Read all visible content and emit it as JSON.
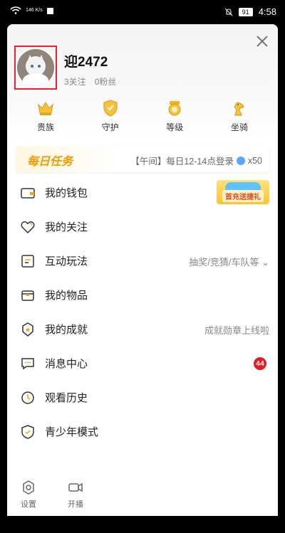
{
  "status_bar": {
    "speed": "146\nK/s",
    "battery": "91",
    "time": "4:58"
  },
  "profile": {
    "username": "迎2472",
    "following": "3关注",
    "fans": "0粉丝"
  },
  "quick_actions": [
    {
      "label": "贵族",
      "icon": "crown-icon"
    },
    {
      "label": "守护",
      "icon": "shield-icon"
    },
    {
      "label": "等级",
      "icon": "badge-icon"
    },
    {
      "label": "坐骑",
      "icon": "horse-icon"
    }
  ],
  "task": {
    "title": "每日任务",
    "desc": "【午间】每日12-14点登录",
    "reward": "x50"
  },
  "menu": [
    {
      "label": "我的钱包",
      "aside": "",
      "promo": "首充送捷礼"
    },
    {
      "label": "我的关注",
      "aside": ""
    },
    {
      "label": "互动玩法",
      "aside": "抽奖/竞猜/车队等"
    },
    {
      "label": "我的物品",
      "aside": ""
    },
    {
      "label": "我的成就",
      "aside": "成就勋章上线啦"
    },
    {
      "label": "消息中心",
      "aside": "",
      "badge": "44"
    },
    {
      "label": "观看历史",
      "aside": ""
    },
    {
      "label": "青少年模式",
      "aside": ""
    }
  ],
  "bottom": [
    {
      "label": "设置",
      "icon": "settings-icon"
    },
    {
      "label": "开播",
      "icon": "camera-icon"
    }
  ],
  "colors": {
    "accent": "#f39a00",
    "badge": "#e31b23"
  }
}
